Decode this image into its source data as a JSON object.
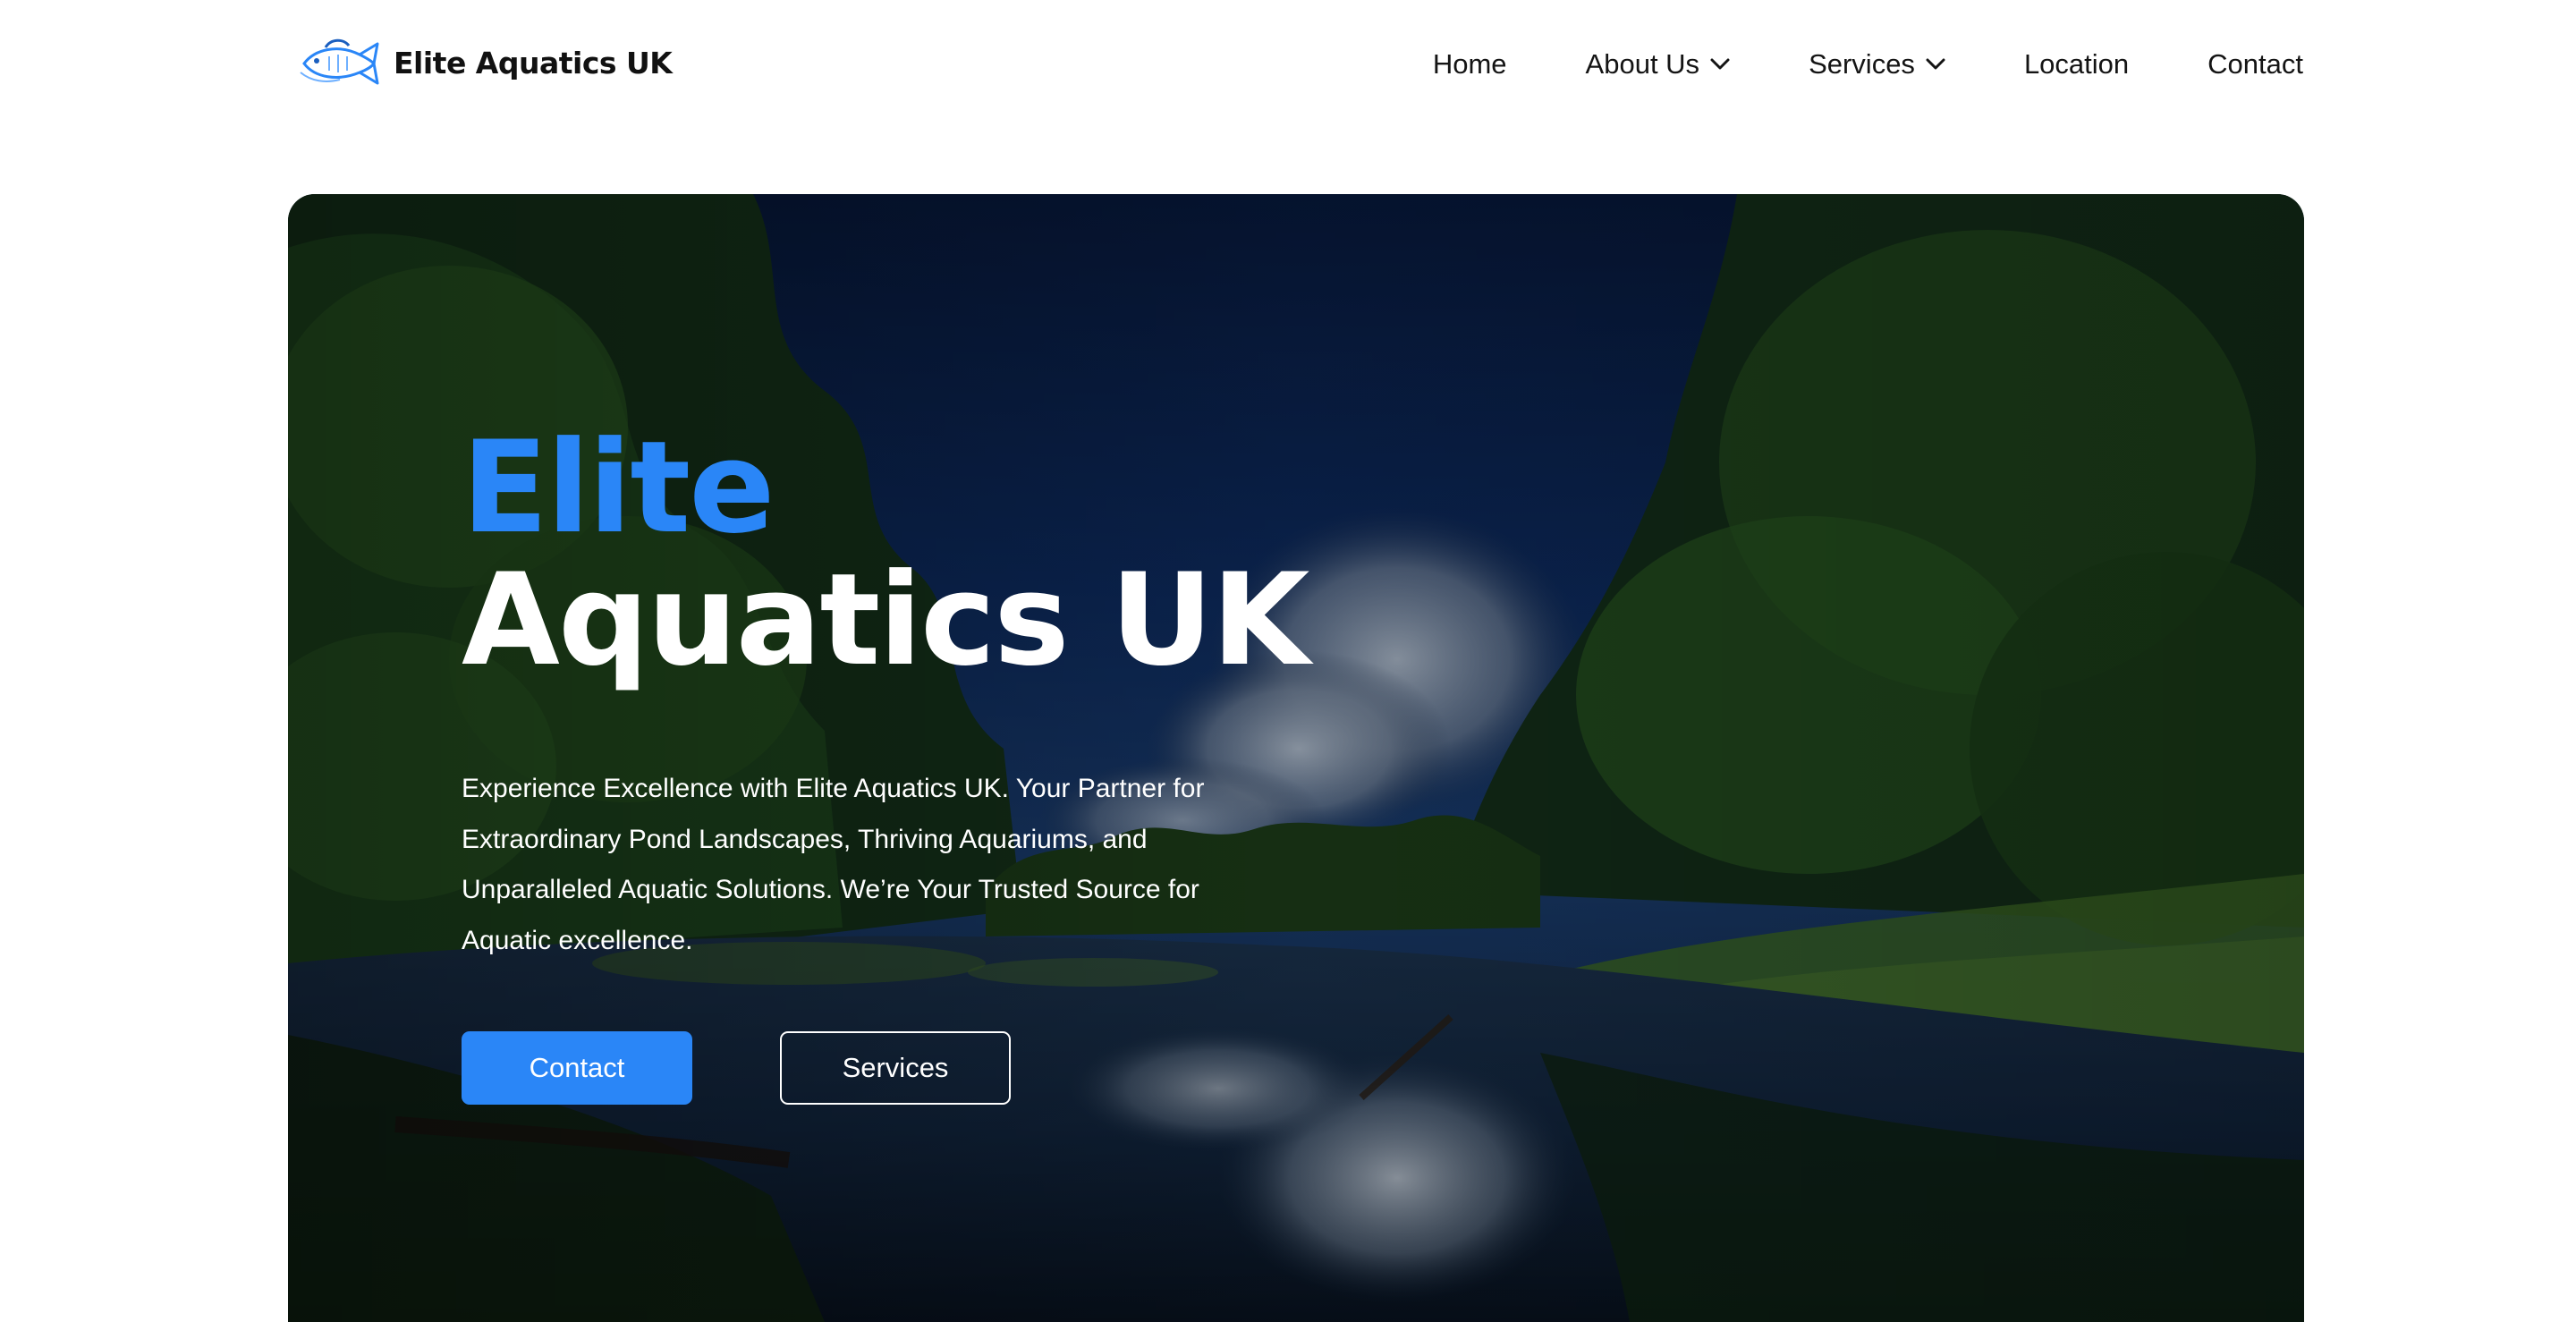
{
  "brand": {
    "name": "Elite Aquatics UK",
    "logo_icon": "fish-logo-icon"
  },
  "nav": {
    "items": [
      {
        "label": "Home",
        "has_dropdown": false
      },
      {
        "label": "About Us",
        "has_dropdown": true
      },
      {
        "label": "Services",
        "has_dropdown": true
      },
      {
        "label": "Location",
        "has_dropdown": false
      },
      {
        "label": "Contact",
        "has_dropdown": false
      }
    ]
  },
  "hero": {
    "title_accent": "Elite",
    "title_main": "Aquatics UK",
    "description": "Experience Excellence with Elite Aquatics UK. Your Partner for Extraordinary Pond Landscapes, Thriving Aquariums, and Unparalleled Aquatic Solutions. We’re Your Trusted Source for Aquatic excellence.",
    "primary_button": "Contact",
    "secondary_button": "Services"
  },
  "colors": {
    "accent": "#2a86f7",
    "text_dark": "#141414",
    "background": "#ffffff"
  }
}
